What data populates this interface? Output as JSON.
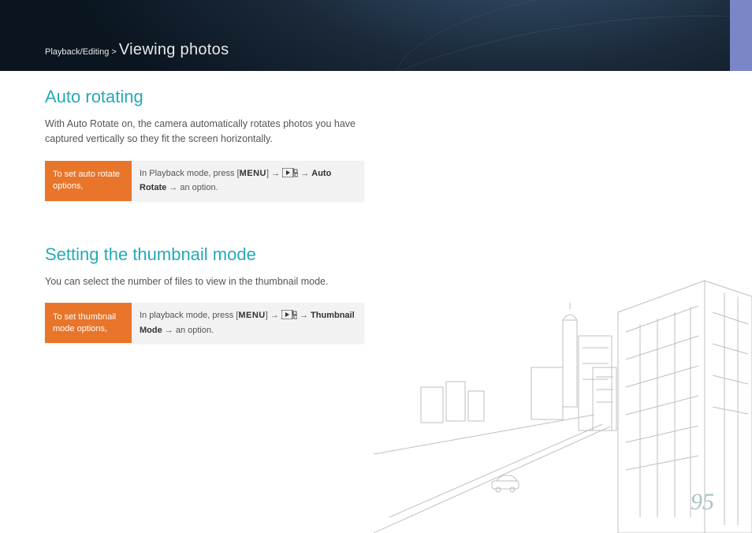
{
  "breadcrumb": {
    "category": "Playback/Editing",
    "separator": ">",
    "section": "Viewing photos"
  },
  "sections": {
    "auto_rotate": {
      "title": "Auto rotating",
      "description": "With Auto Rotate on, the camera automatically rotates photos you have captured vertically so they fit the screen horizontally.",
      "orange_label": "To set auto rotate options,",
      "instruction_prefix": "In Playback mode, press [",
      "instruction_menu": "MENU",
      "instruction_mid1": "] → ",
      "instruction_mid2": " → ",
      "instruction_option": "Auto Rotate",
      "instruction_suffix": " → an option."
    },
    "thumbnail": {
      "title": "Setting the thumbnail mode",
      "description": "You can select the number of files to view in the thumbnail mode.",
      "orange_label": "To set thumbnail mode options,",
      "instruction_prefix": "In playback mode, press [",
      "instruction_menu": "MENU",
      "instruction_mid1": "] → ",
      "instruction_mid2": " → ",
      "instruction_option": "Thumbnail Mode",
      "instruction_suffix": " → an option."
    }
  },
  "page_number": "95"
}
